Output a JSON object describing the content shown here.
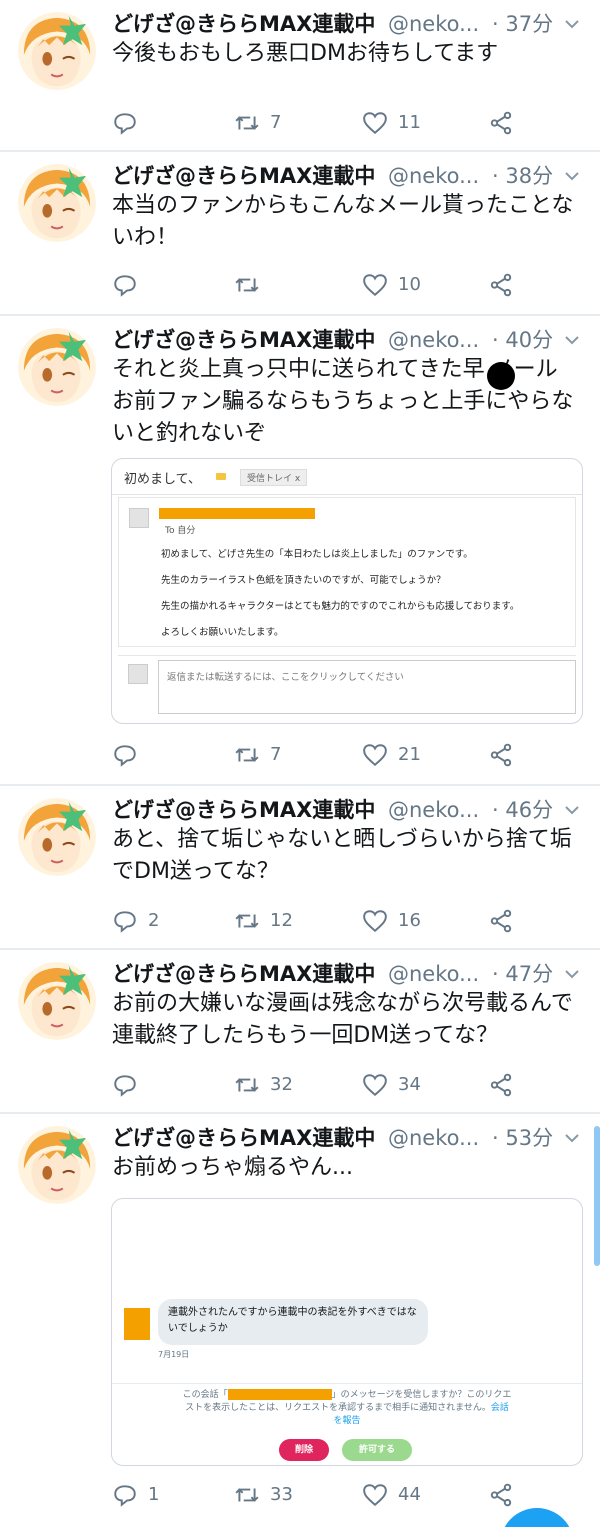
{
  "colors": {
    "accent": "#1da1f2",
    "text": "#14171a",
    "muted": "#657786",
    "redaction": "#f4a000"
  },
  "tweets": [
    {
      "name": "どげざ@きららMAX連載中",
      "handle": "@neko...",
      "time": "· 37分",
      "text": "今後もおもしろ悪口DMお待ちしてます",
      "reply": "",
      "retweet": "7",
      "like": "11"
    },
    {
      "name": "どげざ@きららMAX連載中",
      "handle": "@neko...",
      "time": "· 38分",
      "text": "本当のファンからもこんなメール貰ったことないわ！",
      "reply": "",
      "retweet": "",
      "like": "10"
    },
    {
      "name": "どげざ@きららMAX連載中",
      "handle": "@neko...",
      "time": "· 40分",
      "text": "それと炎上真っ只中に送られてきた早 メール\nお前ファン騙るならもうちょっと上手にやらないと釣れないぞ",
      "reply": "",
      "retweet": "7",
      "like": "21",
      "email": {
        "subject": "初めまして、",
        "label": "受信トレイ x",
        "to": "To 自分",
        "lines": [
          "初めまして、どげさ先生の「本日わたしは炎上しました」のファンです。",
          "先生のカラーイラスト色紙を頂きたいのですが、可能でしょうか？",
          "先生の描かれるキャラクターはとても魅力的ですのでこれからも応援しております。",
          "よろしくお願いいたします。"
        ],
        "reply_placeholder": "返信または転送するには、ここをクリックしてください"
      }
    },
    {
      "name": "どげざ@きららMAX連載中",
      "handle": "@neko...",
      "time": "· 46分",
      "text": "あと、捨て垢じゃないと晒しづらいから捨て垢でDM送ってな？",
      "reply": "2",
      "retweet": "12",
      "like": "16"
    },
    {
      "name": "どげざ@きららMAX連載中",
      "handle": "@neko...",
      "time": "· 47分",
      "text": "お前の大嫌いな漫画は残念ながら次号載るんで\n連載終了したらもう一回DM送ってな？",
      "reply": "",
      "retweet": "32",
      "like": "34"
    },
    {
      "name": "どげざ@きららMAX連載中",
      "handle": "@neko...",
      "time": "· 53分",
      "text": "お前めっちゃ煽るやん...",
      "reply": "1",
      "retweet": "33",
      "like": "44",
      "dm": {
        "message": "連載外されたんですから連載中の表記を外すべきではないでしょうか",
        "date": "7月19日",
        "request_pre": "この会話「",
        "request_post": "」のメッセージを受信しますか？このリクエストを表示したことは、リクエストを承認するまで相手に通知されません。",
        "report": "会話を報告",
        "delete": "削除",
        "allow": "許可する"
      }
    }
  ]
}
